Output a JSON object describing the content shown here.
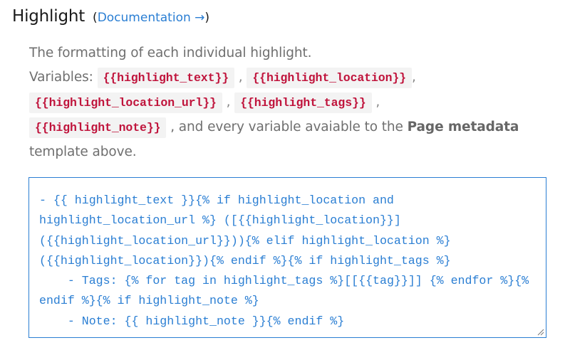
{
  "section": {
    "title": "Highlight",
    "doc_open": "(",
    "doc_link_label": "Documentation →",
    "doc_close": ")"
  },
  "description": {
    "line1": "The formatting of each individual highlight.",
    "variables_label": "Variables:",
    "variables": [
      "{{highlight_text}}",
      "{{highlight_location}}",
      "{{highlight_location_url}}",
      "{{highlight_tags}}",
      "{{highlight_note}}"
    ],
    "comma": ",",
    "tail_text": ", and every variable avaiable to the",
    "tail_bold": "Page metadata",
    "tail_end": "template above."
  },
  "editor": {
    "value": "- {{ highlight_text }}{% if highlight_location and highlight_location_url %} ([{{highlight_location}}]({{highlight_location_url}})){% elif highlight_location %} ({{highlight_location}}){% endif %}{% if highlight_tags %}\n    - Tags: {% for tag in highlight_tags %}[[{{tag}}]] {% endfor %}{% endif %}{% if highlight_note %}\n    - Note: {{ highlight_note }}{% endif %}"
  },
  "colors": {
    "accent": "#2a7ed3",
    "variable_text": "#c0143c",
    "variable_bg": "#f3f3f3",
    "description_text": "#6f6f6f"
  }
}
